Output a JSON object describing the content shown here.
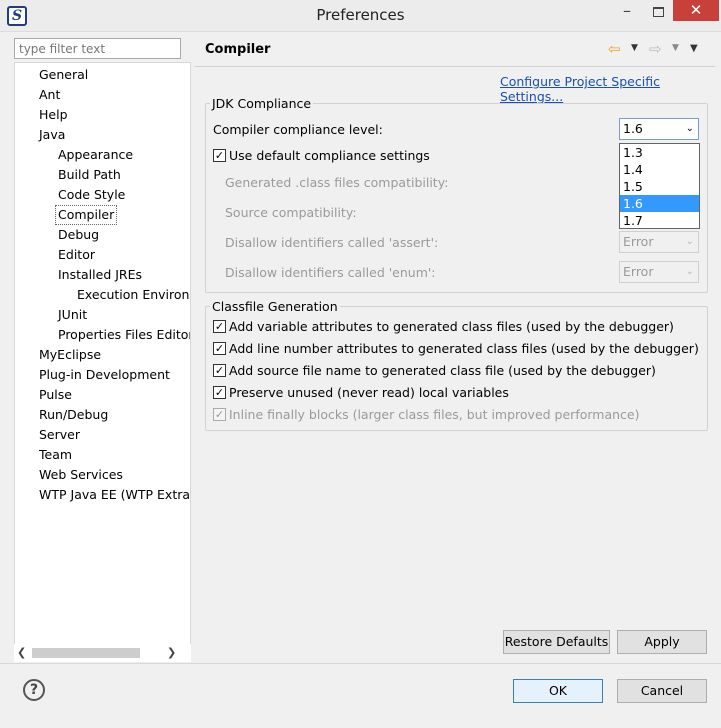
{
  "window": {
    "title": "Preferences",
    "close_glyph": "✕",
    "minimize_glyph": "–",
    "icon_letter": "S"
  },
  "filter": {
    "placeholder": "type filter text"
  },
  "tree": {
    "items": [
      {
        "label": "General",
        "level": 0
      },
      {
        "label": "Ant",
        "level": 0
      },
      {
        "label": "Help",
        "level": 0
      },
      {
        "label": "Java",
        "level": 0
      },
      {
        "label": "Appearance",
        "level": 1
      },
      {
        "label": "Build Path",
        "level": 1
      },
      {
        "label": "Code Style",
        "level": 1
      },
      {
        "label": "Compiler",
        "level": 1,
        "selected": true
      },
      {
        "label": "Debug",
        "level": 1
      },
      {
        "label": "Editor",
        "level": 1
      },
      {
        "label": "Installed JREs",
        "level": 1
      },
      {
        "label": "Execution Environments",
        "level": 2
      },
      {
        "label": "JUnit",
        "level": 1
      },
      {
        "label": "Properties Files Editor",
        "level": 1
      },
      {
        "label": "MyEclipse",
        "level": 0
      },
      {
        "label": "Plug-in Development",
        "level": 0
      },
      {
        "label": "Pulse",
        "level": 0
      },
      {
        "label": "Run/Debug",
        "level": 0
      },
      {
        "label": "Server",
        "level": 0
      },
      {
        "label": "Team",
        "level": 0
      },
      {
        "label": "Web Services",
        "level": 0
      },
      {
        "label": "WTP Java EE (WTP Extras)",
        "level": 0
      }
    ]
  },
  "page": {
    "title": "Compiler",
    "config_link": "Configure Project Specific Settings...",
    "jdk_group": {
      "legend": "JDK Compliance",
      "level_label": "Compiler compliance level:",
      "level_value": "1.6",
      "level_options": [
        "1.3",
        "1.4",
        "1.5",
        "1.6",
        "1.7"
      ],
      "use_default_label": "Use default compliance settings",
      "use_default_checked": true,
      "disabled_rows": [
        {
          "label": "Generated .class files compatibility:",
          "value": ""
        },
        {
          "label": "Source compatibility:",
          "value": ""
        },
        {
          "label": "Disallow identifiers called 'assert':",
          "value": "Error"
        },
        {
          "label": "Disallow identifiers called 'enum':",
          "value": "Error"
        }
      ]
    },
    "classfile_group": {
      "legend": "Classfile Generation",
      "options": [
        {
          "label": "Add variable attributes to generated class files (used by the debugger)",
          "checked": true,
          "enabled": true
        },
        {
          "label": "Add line number attributes to generated class files (used by the debugger)",
          "checked": true,
          "enabled": true
        },
        {
          "label": "Add source file name to generated class file (used by the debugger)",
          "checked": true,
          "enabled": true
        },
        {
          "label": "Preserve unused (never read) local variables",
          "checked": true,
          "enabled": true
        },
        {
          "label": "Inline finally blocks (larger class files, but improved performance)",
          "checked": true,
          "enabled": false
        }
      ]
    },
    "restore_defaults_label": "Restore Defaults",
    "apply_label": "Apply"
  },
  "footer": {
    "help_glyph": "?",
    "ok_label": "OK",
    "cancel_label": "Cancel"
  },
  "icons": {
    "back": "back-arrow-icon",
    "forward": "forward-arrow-icon",
    "view_menu": "view-menu-icon",
    "help": "help-icon",
    "check_glyph": "✓"
  },
  "colors": {
    "link": "#1a4fb3",
    "highlight": "#3399ff",
    "close_button": "#c7413a"
  }
}
